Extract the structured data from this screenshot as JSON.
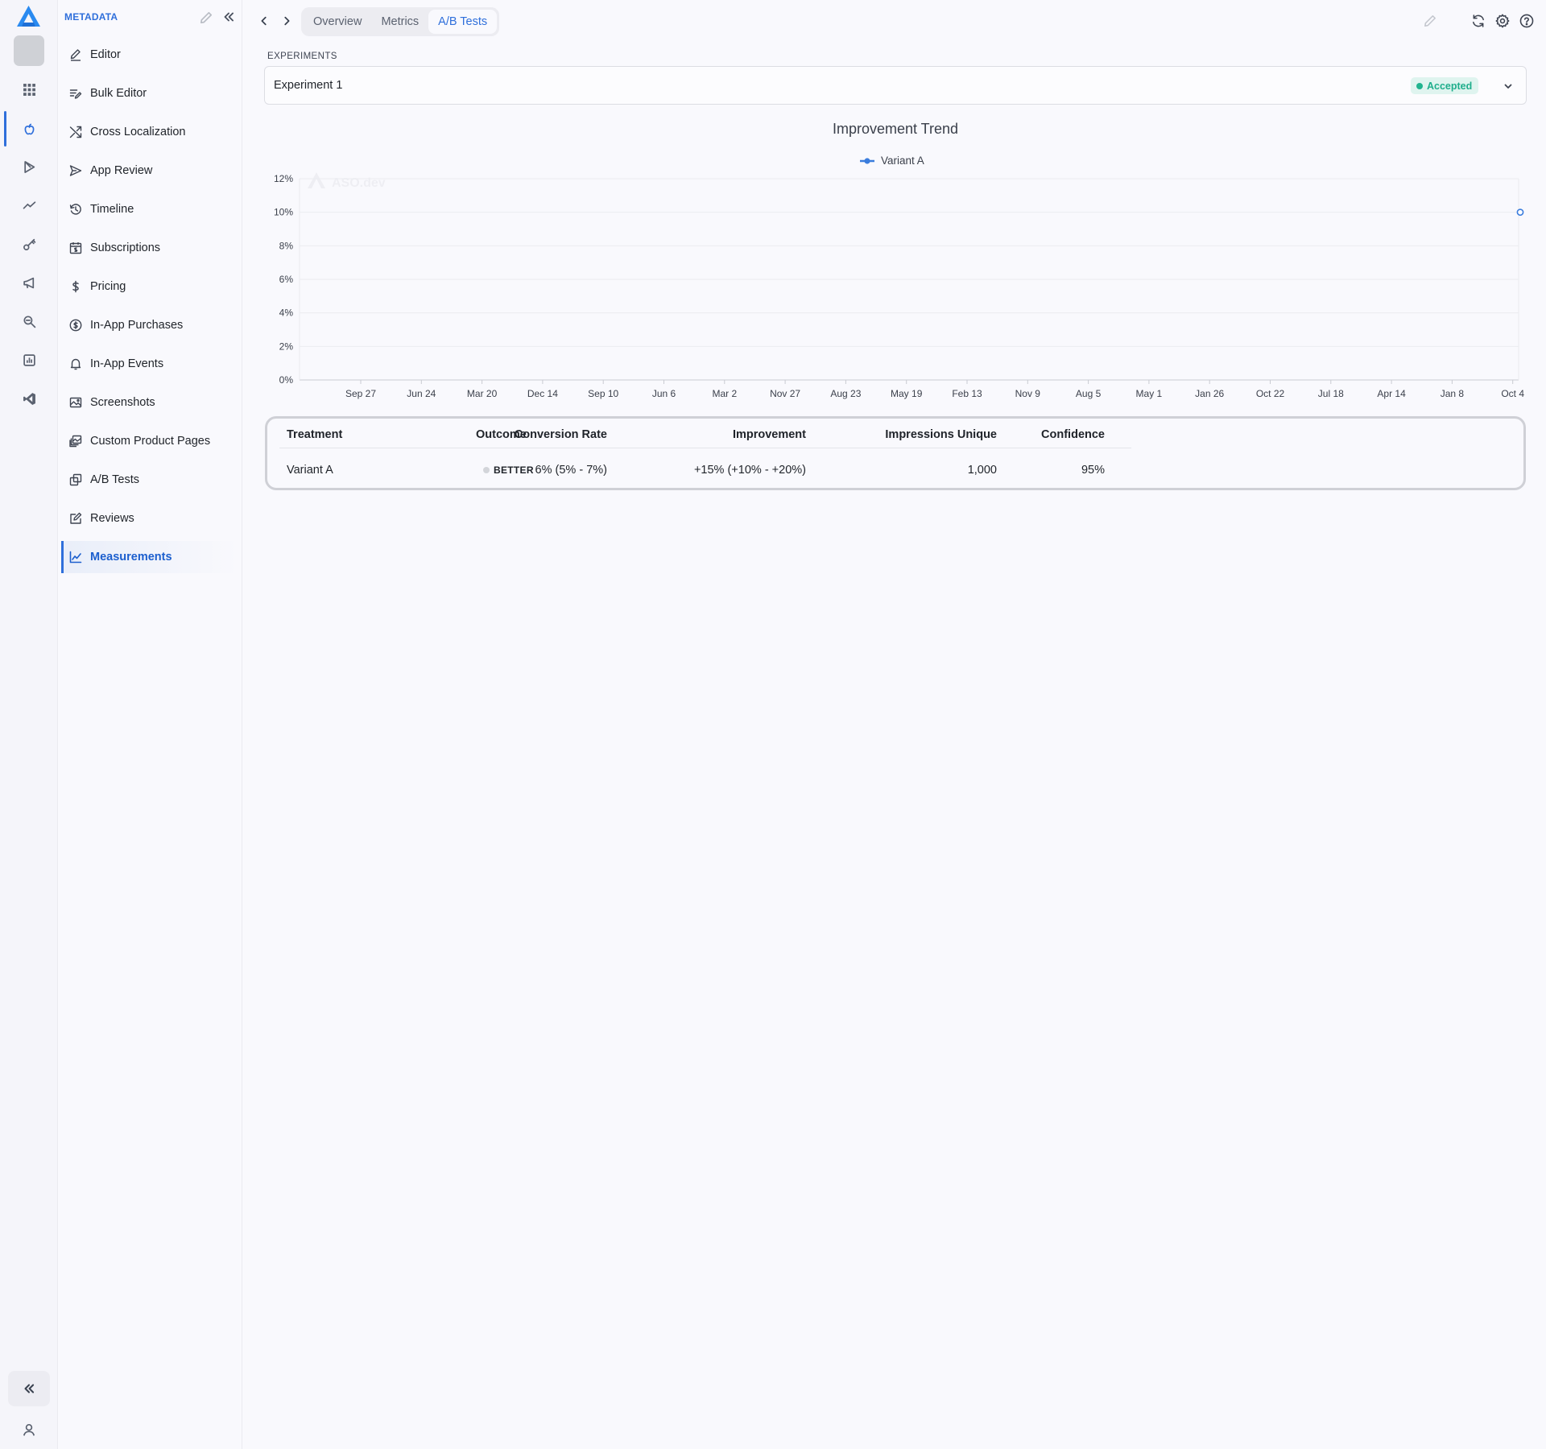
{
  "sidebar": {
    "heading": "METADATA",
    "items": [
      {
        "label": "Editor",
        "icon": "pencil-line-icon"
      },
      {
        "label": "Bulk Editor",
        "icon": "list-edit-icon"
      },
      {
        "label": "Cross Localization",
        "icon": "shuffle-icon"
      },
      {
        "label": "App Review",
        "icon": "send-icon"
      },
      {
        "label": "Timeline",
        "icon": "history-icon"
      },
      {
        "label": "Subscriptions",
        "icon": "calendar-dollar-icon"
      },
      {
        "label": "Pricing",
        "icon": "dollar-icon"
      },
      {
        "label": "In-App Purchases",
        "icon": "coin-icon"
      },
      {
        "label": "In-App Events",
        "icon": "bell-icon"
      },
      {
        "label": "Screenshots",
        "icon": "image-icon"
      },
      {
        "label": "Custom Product Pages",
        "icon": "pages-icon"
      },
      {
        "label": "A/B Tests",
        "icon": "copy-icon"
      },
      {
        "label": "Reviews",
        "icon": "review-icon"
      },
      {
        "label": "Measurements",
        "icon": "line-chart-icon",
        "active": true
      }
    ]
  },
  "tabs": [
    {
      "label": "Overview"
    },
    {
      "label": "Metrics"
    },
    {
      "label": "A/B Tests",
      "active": true
    }
  ],
  "experiments": {
    "label": "EXPERIMENTS",
    "selected": "Experiment 1",
    "status": "Accepted"
  },
  "chart_data": {
    "type": "line",
    "title": "Improvement Trend",
    "xlabel": "",
    "ylabel": "",
    "x_ticks": [
      "Sep 27",
      "Jun 24",
      "Mar 20",
      "Dec 14",
      "Sep 10",
      "Jun 6",
      "Mar 2",
      "Nov 27",
      "Aug 23",
      "May 19",
      "Feb 13",
      "Nov 9",
      "Aug 5",
      "May 1",
      "Jan 26",
      "Oct 22",
      "Jul 18",
      "Apr 14",
      "Jan 8",
      "Oct 4"
    ],
    "y_ticks": [
      "0%",
      "2%",
      "4%",
      "6%",
      "8%",
      "10%",
      "12%"
    ],
    "ylim": [
      0,
      12
    ],
    "grid": true,
    "legend": "top-center",
    "series": [
      {
        "name": "Variant A",
        "color": "#3b7ddd",
        "points": [
          {
            "x": "Oct 4",
            "y": 10
          }
        ]
      }
    ]
  },
  "watermark": "ASO.dev",
  "table": {
    "headers": [
      "Treatment",
      "Outcome",
      "Conversion Rate",
      "Improvement",
      "Impressions Unique",
      "Confidence"
    ],
    "rows": [
      {
        "treatment": "Variant A",
        "outcome": "BETTER",
        "conversion_rate": "6% (5% - 7%)",
        "improvement": "+15% (+10% - +20%)",
        "impressions_unique": "1,000",
        "confidence": "95%"
      }
    ]
  },
  "colors": {
    "accent": "#2f6fdb",
    "accepted": "#1fae8c",
    "series": "#3b7ddd"
  }
}
